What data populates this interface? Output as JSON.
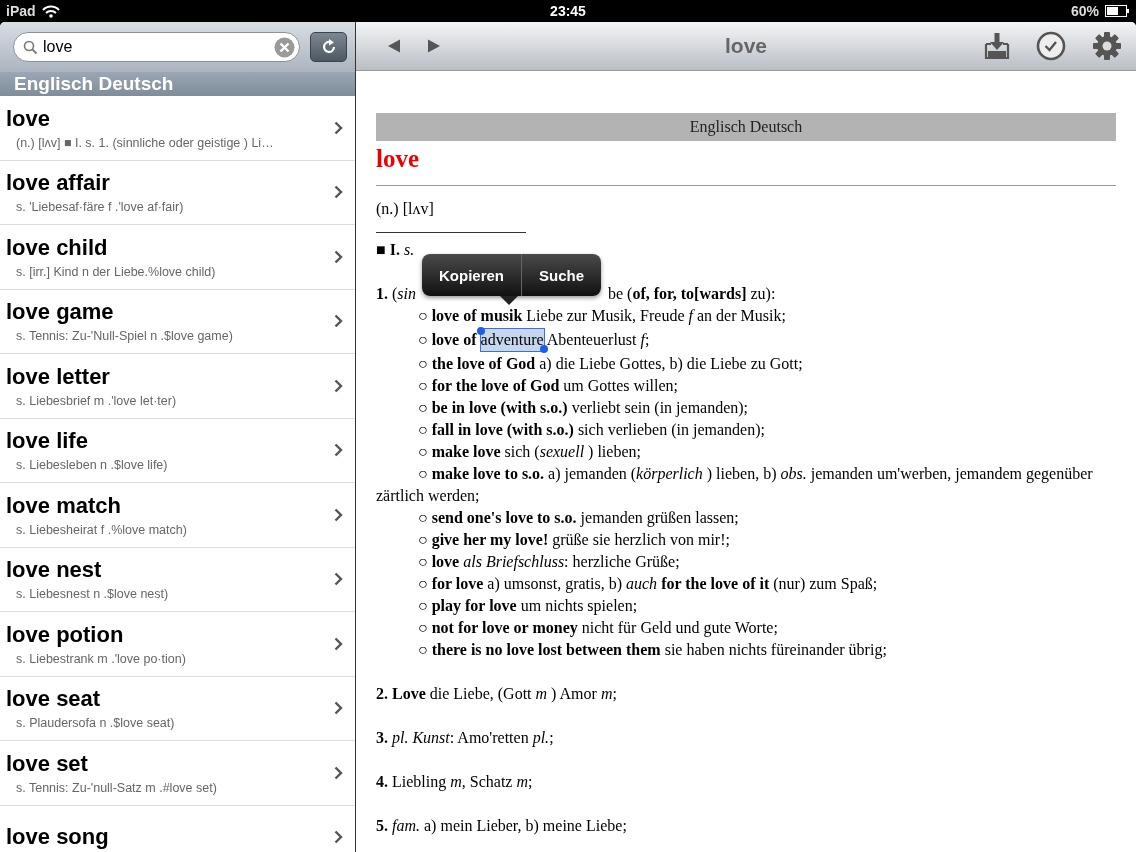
{
  "status_bar": {
    "device": "iPad",
    "time": "23:45",
    "battery": "60%"
  },
  "sidebar": {
    "search": {
      "value": "love"
    },
    "section": "Englisch Deutsch",
    "results": [
      {
        "term": "love",
        "summary": "(n.) [lʌv] ■ I. s.  1. (sinnliche oder geistige ) Li…"
      },
      {
        "term": "love affair",
        "summary": "s. 'Liebesaf·färe f .'love af·fair)"
      },
      {
        "term": "love child",
        "summary": "s. [irr.] Kind n der Liebe.%love child)"
      },
      {
        "term": "love game",
        "summary": "s.  Tennis: Zu-'Null-Spiel n .$love game)"
      },
      {
        "term": "love letter",
        "summary": "s. Liebesbrief m .'love let·ter)"
      },
      {
        "term": "love life",
        "summary": "s. Liebesleben n .$love life)"
      },
      {
        "term": "love match",
        "summary": "s. Liebesheirat f .%love match)"
      },
      {
        "term": "love nest",
        "summary": "s. Liebesnest n .$love nest)"
      },
      {
        "term": "love potion",
        "summary": "s. Liebestrank m .'love po·tion)"
      },
      {
        "term": "love seat",
        "summary": "s. Plaudersofa n .$love seat)"
      },
      {
        "term": "love set",
        "summary": "s.  Tennis: Zu-'null-Satz m .#love set)"
      },
      {
        "term": "love song"
      }
    ]
  },
  "detail": {
    "title": "love",
    "dictionary": "Englisch Deutsch",
    "headword": "love",
    "blocks": [
      {
        "kind": "pron",
        "text": "(n.) [lʌv]"
      },
      {
        "kind": "rule"
      },
      {
        "kind": "section",
        "text": "■ **I.** *s.*"
      },
      {
        "kind": "covered",
        "text": "**1.** (*sin*",
        "text_after": "be (**of, for, to[wards]** zu):"
      },
      {
        "kind": "item",
        "text": "○ **love of musik** Liebe zur Musik, Freude *f* an der Musik;"
      },
      {
        "kind": "selection",
        "text": "○ **love of**",
        "selection": "adventure",
        "text_after": "Abenteuerlust *f*;"
      },
      {
        "kind": "item",
        "text": "○ **the love of God** a) die Liebe Gottes, b) die Liebe zu Gott;"
      },
      {
        "kind": "item",
        "text": "○ **for the love of God** um Gottes willen;"
      },
      {
        "kind": "item",
        "text": "○ **be in love (with s.o.)** verliebt sein (in jemanden);"
      },
      {
        "kind": "item",
        "text": "○ **fall in love (with s.o.)** sich verlieben (in jemanden);"
      },
      {
        "kind": "item",
        "text": "○ **make love** sich (*sexuell* ) lieben;"
      },
      {
        "kind": "item",
        "text": "○ **make love to s.o.** a) jemanden (*körperlich* ) lieben, b) *obs.* jemanden um'werben, jemandem gegenüber zärtlich werden;"
      },
      {
        "kind": "item",
        "text": "○ **send one's love to s.o.** jemanden grüßen lassen;"
      },
      {
        "kind": "item",
        "text": "○ **give her my love!** grüße sie herzlich von mir!;"
      },
      {
        "kind": "item",
        "text": "○ **love** *als Briefschluss*: herzliche Grüße;"
      },
      {
        "kind": "item",
        "text": "○ **for love** a) umsonst, gratis, b) *auch* **for the love of it** (nur) zum Spaß;"
      },
      {
        "kind": "item",
        "text": "○ **play for love** um nichts spielen;"
      },
      {
        "kind": "item",
        "text": "○ **not for love or money** nicht für Geld und gute Worte;"
      },
      {
        "kind": "item",
        "text": "○ **there is no love lost between them** sie haben nichts füreinander übrig;"
      },
      {
        "kind": "sense",
        "text": "**2. Love** die Liebe, (Gott *m* ) Amor *m*;"
      },
      {
        "kind": "sense",
        "text": "**3.** *pl. Kunst*: Amo'retten *pl.*;"
      },
      {
        "kind": "sense",
        "text": "**4.** Liebling *m*, Schatz *m*;"
      },
      {
        "kind": "sense",
        "text": "**5.** *fam.* a) mein Lieber, b) meine Liebe;"
      }
    ]
  },
  "popup": {
    "buttons": [
      "Kopieren",
      "Suche"
    ]
  }
}
